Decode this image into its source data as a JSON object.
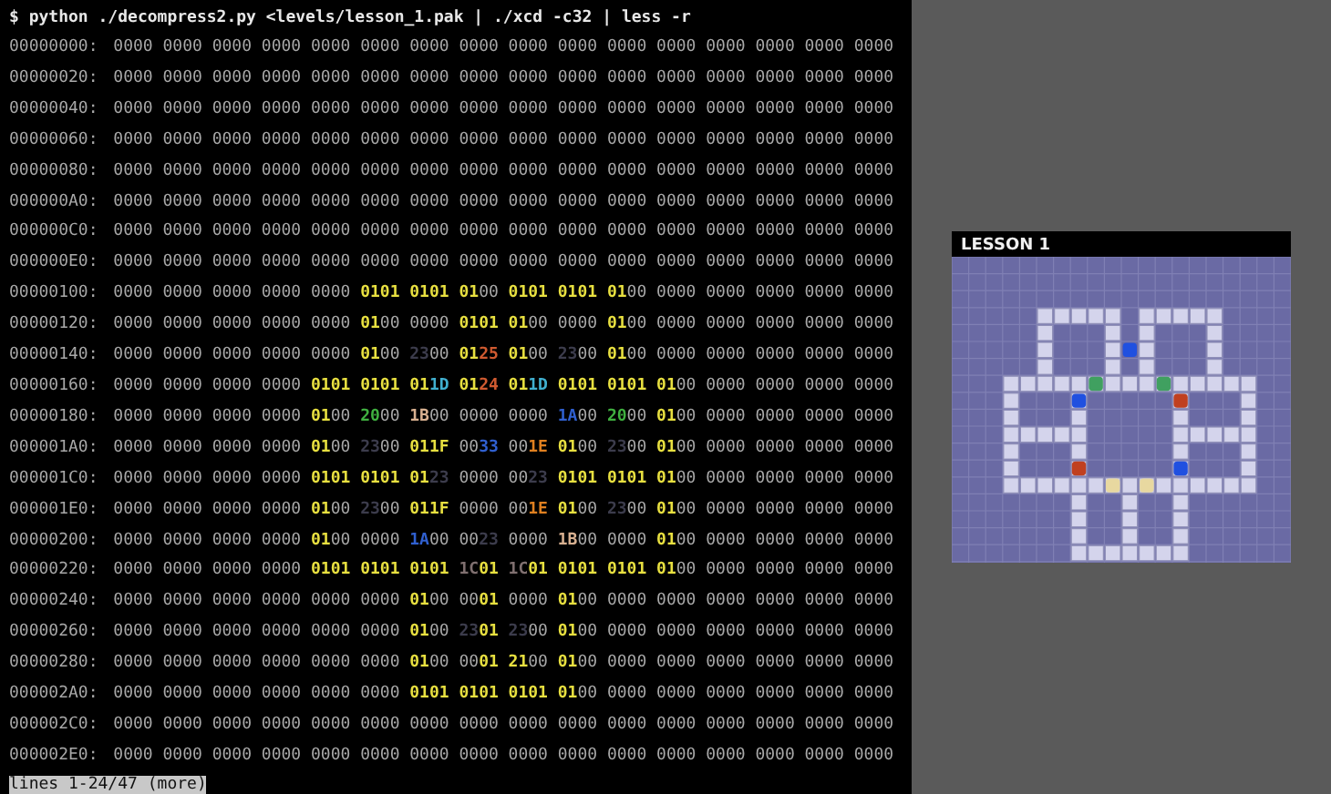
{
  "terminal": {
    "command": "$ python ./decompress2.py <levels/lesson_1.pak | ./xcd -c32 | less -r",
    "rows": [
      {
        "address": "00000000:",
        "words": [
          "0000",
          "0000",
          "0000",
          "0000",
          "0000",
          "0000",
          "0000",
          "0000",
          "0000",
          "0000",
          "0000",
          "0000",
          "0000",
          "0000",
          "0000",
          "0000"
        ]
      },
      {
        "address": "00000020:",
        "words": [
          "0000",
          "0000",
          "0000",
          "0000",
          "0000",
          "0000",
          "0000",
          "0000",
          "0000",
          "0000",
          "0000",
          "0000",
          "0000",
          "0000",
          "0000",
          "0000"
        ]
      },
      {
        "address": "00000040:",
        "words": [
          "0000",
          "0000",
          "0000",
          "0000",
          "0000",
          "0000",
          "0000",
          "0000",
          "0000",
          "0000",
          "0000",
          "0000",
          "0000",
          "0000",
          "0000",
          "0000"
        ]
      },
      {
        "address": "00000060:",
        "words": [
          "0000",
          "0000",
          "0000",
          "0000",
          "0000",
          "0000",
          "0000",
          "0000",
          "0000",
          "0000",
          "0000",
          "0000",
          "0000",
          "0000",
          "0000",
          "0000"
        ]
      },
      {
        "address": "00000080:",
        "words": [
          "0000",
          "0000",
          "0000",
          "0000",
          "0000",
          "0000",
          "0000",
          "0000",
          "0000",
          "0000",
          "0000",
          "0000",
          "0000",
          "0000",
          "0000",
          "0000"
        ]
      },
      {
        "address": "000000A0:",
        "words": [
          "0000",
          "0000",
          "0000",
          "0000",
          "0000",
          "0000",
          "0000",
          "0000",
          "0000",
          "0000",
          "0000",
          "0000",
          "0000",
          "0000",
          "0000",
          "0000"
        ]
      },
      {
        "address": "000000C0:",
        "words": [
          "0000",
          "0000",
          "0000",
          "0000",
          "0000",
          "0000",
          "0000",
          "0000",
          "0000",
          "0000",
          "0000",
          "0000",
          "0000",
          "0000",
          "0000",
          "0000"
        ]
      },
      {
        "address": "000000E0:",
        "words": [
          "0000",
          "0000",
          "0000",
          "0000",
          "0000",
          "0000",
          "0000",
          "0000",
          "0000",
          "0000",
          "0000",
          "0000",
          "0000",
          "0000",
          "0000",
          "0000"
        ]
      },
      {
        "address": "00000100:",
        "words": [
          "0000",
          "0000",
          "0000",
          "0000",
          "0000",
          {
            "text": "0101",
            "bytes": [
              {
                "color": "#e8e040"
              },
              {
                "color": "#e8e040"
              }
            ]
          },
          {
            "text": "0101",
            "bytes": [
              {
                "color": "#e8e040"
              },
              {
                "color": "#e8e040"
              }
            ]
          },
          {
            "text": "0100",
            "bytes": [
              {
                "color": "#e8e040"
              },
              {
                "color": "#a8a8a8"
              }
            ]
          },
          {
            "text": "0101",
            "bytes": [
              {
                "color": "#e8e040"
              },
              {
                "color": "#e8e040"
              }
            ]
          },
          {
            "text": "0101",
            "bytes": [
              {
                "color": "#e8e040"
              },
              {
                "color": "#e8e040"
              }
            ]
          },
          {
            "text": "0100",
            "bytes": [
              {
                "color": "#e8e040"
              },
              {
                "color": "#a8a8a8"
              }
            ]
          },
          "0000",
          "0000",
          "0000",
          "0000",
          "0000"
        ]
      },
      {
        "address": "00000120:",
        "words": [
          "0000",
          "0000",
          "0000",
          "0000",
          "0000",
          {
            "text": "0100",
            "bytes": [
              {
                "color": "#e8e040"
              },
              {
                "color": "#a8a8a8"
              }
            ]
          },
          "0000",
          {
            "text": "0101",
            "bytes": [
              {
                "color": "#e8e040"
              },
              {
                "color": "#e8e040"
              }
            ]
          },
          {
            "text": "0100",
            "bytes": [
              {
                "color": "#e8e040"
              },
              {
                "color": "#a8a8a8"
              }
            ]
          },
          "0000",
          {
            "text": "0100",
            "bytes": [
              {
                "color": "#e8e040"
              },
              {
                "color": "#a8a8a8"
              }
            ]
          },
          "0000",
          "0000",
          "0000",
          "0000",
          "0000"
        ]
      },
      {
        "address": "00000140:",
        "words": [
          "0000",
          "0000",
          "0000",
          "0000",
          "0000",
          {
            "text": "0100",
            "bytes": [
              {
                "color": "#e8e040"
              },
              {
                "color": "#a8a8a8"
              }
            ]
          },
          {
            "text": "2300",
            "bytes": [
              {
                "color": "#3c3c4c"
              },
              {
                "color": "#a8a8a8"
              }
            ]
          },
          {
            "text": "0125",
            "bytes": [
              {
                "color": "#e8e040"
              },
              {
                "color": "#d05a30"
              }
            ]
          },
          {
            "text": "0100",
            "bytes": [
              {
                "color": "#e8e040"
              },
              {
                "color": "#a8a8a8"
              }
            ]
          },
          {
            "text": "2300",
            "bytes": [
              {
                "color": "#3c3c4c"
              },
              {
                "color": "#a8a8a8"
              }
            ]
          },
          {
            "text": "0100",
            "bytes": [
              {
                "color": "#e8e040"
              },
              {
                "color": "#a8a8a8"
              }
            ]
          },
          "0000",
          "0000",
          "0000",
          "0000",
          "0000"
        ]
      },
      {
        "address": "00000160:",
        "words": [
          "0000",
          "0000",
          "0000",
          "0000",
          {
            "text": "0101",
            "bytes": [
              {
                "color": "#e8e040"
              },
              {
                "color": "#e8e040"
              }
            ]
          },
          {
            "text": "0101",
            "bytes": [
              {
                "color": "#e8e040"
              },
              {
                "color": "#e8e040"
              }
            ]
          },
          {
            "text": "011D",
            "bytes": [
              {
                "color": "#e8e040"
              },
              {
                "color": "#40b0d0"
              }
            ]
          },
          {
            "text": "0124",
            "bytes": [
              {
                "color": "#e8e040"
              },
              {
                "color": "#d05a30"
              }
            ]
          },
          {
            "text": "011D",
            "bytes": [
              {
                "color": "#e8e040"
              },
              {
                "color": "#40b0d0"
              }
            ]
          },
          {
            "text": "0101",
            "bytes": [
              {
                "color": "#e8e040"
              },
              {
                "color": "#e8e040"
              }
            ]
          },
          {
            "text": "0101",
            "bytes": [
              {
                "color": "#e8e040"
              },
              {
                "color": "#e8e040"
              }
            ]
          },
          {
            "text": "0100",
            "bytes": [
              {
                "color": "#e8e040"
              },
              {
                "color": "#a8a8a8"
              }
            ]
          },
          "0000",
          "0000",
          "0000",
          "0000"
        ]
      },
      {
        "address": "00000180:",
        "words": [
          "0000",
          "0000",
          "0000",
          "0000",
          {
            "text": "0100",
            "bytes": [
              {
                "color": "#e8e040"
              },
              {
                "color": "#a8a8a8"
              }
            ]
          },
          {
            "text": "2000",
            "bytes": [
              {
                "color": "#40b040"
              },
              {
                "color": "#a8a8a8"
              }
            ]
          },
          {
            "text": "1B00",
            "bytes": [
              {
                "color": "#d8b090"
              },
              {
                "color": "#a8a8a8"
              }
            ]
          },
          "0000",
          "0000",
          {
            "text": "1A00",
            "bytes": [
              {
                "color": "#3060d0"
              },
              {
                "color": "#a8a8a8"
              }
            ]
          },
          {
            "text": "2000",
            "bytes": [
              {
                "color": "#40b040"
              },
              {
                "color": "#a8a8a8"
              }
            ]
          },
          {
            "text": "0100",
            "bytes": [
              {
                "color": "#e8e040"
              },
              {
                "color": "#a8a8a8"
              }
            ]
          },
          "0000",
          "0000",
          "0000",
          "0000"
        ]
      },
      {
        "address": "000001A0:",
        "words": [
          "0000",
          "0000",
          "0000",
          "0000",
          {
            "text": "0100",
            "bytes": [
              {
                "color": "#e8e040"
              },
              {
                "color": "#a8a8a8"
              }
            ]
          },
          {
            "text": "2300",
            "bytes": [
              {
                "color": "#3c3c4c"
              },
              {
                "color": "#a8a8a8"
              }
            ]
          },
          {
            "text": "011F",
            "bytes": [
              {
                "color": "#e8e040"
              },
              {
                "color": "#e8e040"
              }
            ]
          },
          {
            "text": "0033",
            "bytes": [
              {
                "color": "#a8a8a8"
              },
              {
                "color": "#3060d0"
              }
            ]
          },
          {
            "text": "001E",
            "bytes": [
              {
                "color": "#a8a8a8"
              },
              {
                "color": "#e08020"
              }
            ]
          },
          {
            "text": "0100",
            "bytes": [
              {
                "color": "#e8e040"
              },
              {
                "color": "#a8a8a8"
              }
            ]
          },
          {
            "text": "2300",
            "bytes": [
              {
                "color": "#3c3c4c"
              },
              {
                "color": "#a8a8a8"
              }
            ]
          },
          {
            "text": "0100",
            "bytes": [
              {
                "color": "#e8e040"
              },
              {
                "color": "#a8a8a8"
              }
            ]
          },
          "0000",
          "0000",
          "0000",
          "0000"
        ]
      },
      {
        "address": "000001C0:",
        "words": [
          "0000",
          "0000",
          "0000",
          "0000",
          {
            "text": "0101",
            "bytes": [
              {
                "color": "#e8e040"
              },
              {
                "color": "#e8e040"
              }
            ]
          },
          {
            "text": "0101",
            "bytes": [
              {
                "color": "#e8e040"
              },
              {
                "color": "#e8e040"
              }
            ]
          },
          {
            "text": "0123",
            "bytes": [
              {
                "color": "#e8e040"
              },
              {
                "color": "#3c3c4c"
              }
            ]
          },
          "0000",
          {
            "text": "0023",
            "bytes": [
              {
                "color": "#a8a8a8"
              },
              {
                "color": "#3c3c4c"
              }
            ]
          },
          {
            "text": "0101",
            "bytes": [
              {
                "color": "#e8e040"
              },
              {
                "color": "#e8e040"
              }
            ]
          },
          {
            "text": "0101",
            "bytes": [
              {
                "color": "#e8e040"
              },
              {
                "color": "#e8e040"
              }
            ]
          },
          {
            "text": "0100",
            "bytes": [
              {
                "color": "#e8e040"
              },
              {
                "color": "#a8a8a8"
              }
            ]
          },
          "0000",
          "0000",
          "0000",
          "0000"
        ]
      },
      {
        "address": "000001E0:",
        "words": [
          "0000",
          "0000",
          "0000",
          "0000",
          {
            "text": "0100",
            "bytes": [
              {
                "color": "#e8e040"
              },
              {
                "color": "#a8a8a8"
              }
            ]
          },
          {
            "text": "2300",
            "bytes": [
              {
                "color": "#3c3c4c"
              },
              {
                "color": "#a8a8a8"
              }
            ]
          },
          {
            "text": "011F",
            "bytes": [
              {
                "color": "#e8e040"
              },
              {
                "color": "#e8e040"
              }
            ]
          },
          "0000",
          {
            "text": "001E",
            "bytes": [
              {
                "color": "#a8a8a8"
              },
              {
                "color": "#e08020"
              }
            ]
          },
          {
            "text": "0100",
            "bytes": [
              {
                "color": "#e8e040"
              },
              {
                "color": "#a8a8a8"
              }
            ]
          },
          {
            "text": "2300",
            "bytes": [
              {
                "color": "#3c3c4c"
              },
              {
                "color": "#a8a8a8"
              }
            ]
          },
          {
            "text": "0100",
            "bytes": [
              {
                "color": "#e8e040"
              },
              {
                "color": "#a8a8a8"
              }
            ]
          },
          "0000",
          "0000",
          "0000",
          "0000"
        ]
      },
      {
        "address": "00000200:",
        "words": [
          "0000",
          "0000",
          "0000",
          "0000",
          {
            "text": "0100",
            "bytes": [
              {
                "color": "#e8e040"
              },
              {
                "color": "#a8a8a8"
              }
            ]
          },
          "0000",
          {
            "text": "1A00",
            "bytes": [
              {
                "color": "#3060d0"
              },
              {
                "color": "#a8a8a8"
              }
            ]
          },
          {
            "text": "0023",
            "bytes": [
              {
                "color": "#a8a8a8"
              },
              {
                "color": "#3c3c4c"
              }
            ]
          },
          "0000",
          {
            "text": "1B00",
            "bytes": [
              {
                "color": "#d8b090"
              },
              {
                "color": "#a8a8a8"
              }
            ]
          },
          "0000",
          {
            "text": "0100",
            "bytes": [
              {
                "color": "#e8e040"
              },
              {
                "color": "#a8a8a8"
              }
            ]
          },
          "0000",
          "0000",
          "0000",
          "0000"
        ]
      },
      {
        "address": "00000220:",
        "words": [
          "0000",
          "0000",
          "0000",
          "0000",
          {
            "text": "0101",
            "bytes": [
              {
                "color": "#e8e040"
              },
              {
                "color": "#e8e040"
              }
            ]
          },
          {
            "text": "0101",
            "bytes": [
              {
                "color": "#e8e040"
              },
              {
                "color": "#e8e040"
              }
            ]
          },
          {
            "text": "0101",
            "bytes": [
              {
                "color": "#e8e040"
              },
              {
                "color": "#e8e040"
              }
            ]
          },
          {
            "text": "1C01",
            "bytes": [
              {
                "color": "#807070"
              },
              {
                "color": "#e8e040"
              }
            ]
          },
          {
            "text": "1C01",
            "bytes": [
              {
                "color": "#807070"
              },
              {
                "color": "#e8e040"
              }
            ]
          },
          {
            "text": "0101",
            "bytes": [
              {
                "color": "#e8e040"
              },
              {
                "color": "#e8e040"
              }
            ]
          },
          {
            "text": "0101",
            "bytes": [
              {
                "color": "#e8e040"
              },
              {
                "color": "#e8e040"
              }
            ]
          },
          {
            "text": "0100",
            "bytes": [
              {
                "color": "#e8e040"
              },
              {
                "color": "#a8a8a8"
              }
            ]
          },
          "0000",
          "0000",
          "0000",
          "0000"
        ]
      },
      {
        "address": "00000240:",
        "words": [
          "0000",
          "0000",
          "0000",
          "0000",
          "0000",
          "0000",
          {
            "text": "0100",
            "bytes": [
              {
                "color": "#e8e040"
              },
              {
                "color": "#a8a8a8"
              }
            ]
          },
          {
            "text": "0001",
            "bytes": [
              {
                "color": "#a8a8a8"
              },
              {
                "color": "#e8e040"
              }
            ]
          },
          "0000",
          {
            "text": "0100",
            "bytes": [
              {
                "color": "#e8e040"
              },
              {
                "color": "#a8a8a8"
              }
            ]
          },
          "0000",
          "0000",
          "0000",
          "0000",
          "0000",
          "0000"
        ]
      },
      {
        "address": "00000260:",
        "words": [
          "0000",
          "0000",
          "0000",
          "0000",
          "0000",
          "0000",
          {
            "text": "0100",
            "bytes": [
              {
                "color": "#e8e040"
              },
              {
                "color": "#a8a8a8"
              }
            ]
          },
          {
            "text": "2301",
            "bytes": [
              {
                "color": "#3c3c4c"
              },
              {
                "color": "#e8e040"
              }
            ]
          },
          {
            "text": "2300",
            "bytes": [
              {
                "color": "#3c3c4c"
              },
              {
                "color": "#a8a8a8"
              }
            ]
          },
          {
            "text": "0100",
            "bytes": [
              {
                "color": "#e8e040"
              },
              {
                "color": "#a8a8a8"
              }
            ]
          },
          "0000",
          "0000",
          "0000",
          "0000",
          "0000",
          "0000"
        ]
      },
      {
        "address": "00000280:",
        "words": [
          "0000",
          "0000",
          "0000",
          "0000",
          "0000",
          "0000",
          {
            "text": "0100",
            "bytes": [
              {
                "color": "#e8e040"
              },
              {
                "color": "#a8a8a8"
              }
            ]
          },
          {
            "text": "0001",
            "bytes": [
              {
                "color": "#a8a8a8"
              },
              {
                "color": "#e8e040"
              }
            ]
          },
          {
            "text": "2100",
            "bytes": [
              {
                "color": "#e8e040"
              },
              {
                "color": "#a8a8a8"
              }
            ]
          },
          {
            "text": "0100",
            "bytes": [
              {
                "color": "#e8e040"
              },
              {
                "color": "#a8a8a8"
              }
            ]
          },
          "0000",
          "0000",
          "0000",
          "0000",
          "0000",
          "0000"
        ]
      },
      {
        "address": "000002A0:",
        "words": [
          "0000",
          "0000",
          "0000",
          "0000",
          "0000",
          "0000",
          {
            "text": "0101",
            "bytes": [
              {
                "color": "#e8e040"
              },
              {
                "color": "#e8e040"
              }
            ]
          },
          {
            "text": "0101",
            "bytes": [
              {
                "color": "#e8e040"
              },
              {
                "color": "#e8e040"
              }
            ]
          },
          {
            "text": "0101",
            "bytes": [
              {
                "color": "#e8e040"
              },
              {
                "color": "#e8e040"
              }
            ]
          },
          {
            "text": "0100",
            "bytes": [
              {
                "color": "#e8e040"
              },
              {
                "color": "#a8a8a8"
              }
            ]
          },
          "0000",
          "0000",
          "0000",
          "0000",
          "0000",
          "0000"
        ]
      },
      {
        "address": "000002C0:",
        "words": [
          "0000",
          "0000",
          "0000",
          "0000",
          "0000",
          "0000",
          "0000",
          "0000",
          "0000",
          "0000",
          "0000",
          "0000",
          "0000",
          "0000",
          "0000",
          "0000"
        ]
      },
      {
        "address": "000002E0:",
        "words": [
          "0000",
          "0000",
          "0000",
          "0000",
          "0000",
          "0000",
          "0000",
          "0000",
          "0000",
          "0000",
          "0000",
          "0000",
          "0000",
          "0000",
          "0000",
          "0000"
        ]
      }
    ],
    "status": "lines 1-24/47 (more)"
  },
  "preview": {
    "title": "LESSON 1"
  }
}
